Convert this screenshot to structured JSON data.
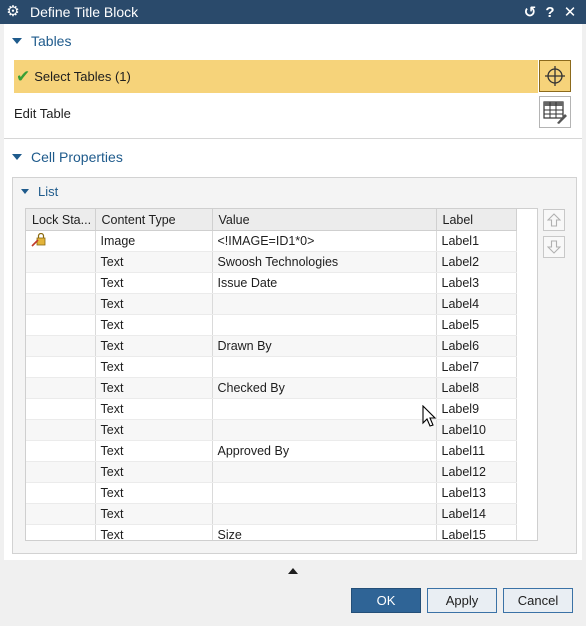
{
  "window": {
    "title": "Define Title Block",
    "buttons": {
      "reset": "↺",
      "help": "?",
      "close": "✕"
    }
  },
  "tables_section": {
    "header": "Tables",
    "select_tables_label": "Select Tables (1)",
    "edit_table_label": "Edit Table"
  },
  "cell_properties": {
    "header": "Cell Properties",
    "list": {
      "header": "List",
      "columns": [
        "Lock Sta...",
        "Content Type",
        "Value",
        "Label"
      ],
      "rows": [
        {
          "lock": "locked",
          "type": "Image",
          "value": "<!IMAGE=ID1*0>",
          "label": "Label1"
        },
        {
          "lock": "",
          "type": "Text",
          "value": "Swoosh Technologies",
          "label": "Label2"
        },
        {
          "lock": "",
          "type": "Text",
          "value": "Issue Date",
          "label": "Label3"
        },
        {
          "lock": "",
          "type": "Text",
          "value": "",
          "label": "Label4"
        },
        {
          "lock": "",
          "type": "Text",
          "value": "",
          "label": "Label5"
        },
        {
          "lock": "",
          "type": "Text",
          "value": "Drawn By",
          "label": "Label6"
        },
        {
          "lock": "",
          "type": "Text",
          "value": "",
          "label": "Label7"
        },
        {
          "lock": "",
          "type": "Text",
          "value": "Checked By",
          "label": "Label8"
        },
        {
          "lock": "",
          "type": "Text",
          "value": "",
          "label": "Label9"
        },
        {
          "lock": "",
          "type": "Text",
          "value": "",
          "label": "Label10"
        },
        {
          "lock": "",
          "type": "Text",
          "value": "Approved By",
          "label": "Label11"
        },
        {
          "lock": "",
          "type": "Text",
          "value": "",
          "label": "Label12"
        },
        {
          "lock": "",
          "type": "Text",
          "value": "",
          "label": "Label13"
        },
        {
          "lock": "",
          "type": "Text",
          "value": "",
          "label": "Label14"
        },
        {
          "lock": "",
          "type": "Text",
          "value": "Size",
          "label": "Label15"
        }
      ]
    }
  },
  "footer": {
    "ok": "OK",
    "apply": "Apply",
    "cancel": "Cancel"
  },
  "colors": {
    "titlebar": "#2a4a6b",
    "accent": "#1f5b8c",
    "selected_row": "#f6d37a",
    "primary_button": "#2f6496"
  }
}
